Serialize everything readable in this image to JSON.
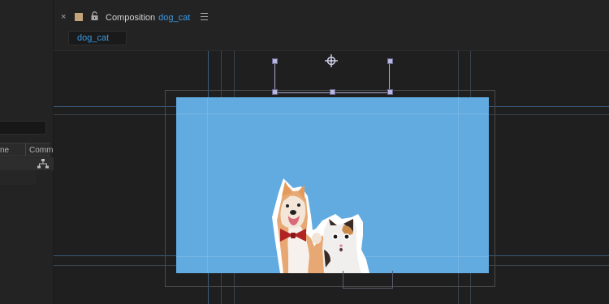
{
  "comp_panel": {
    "close_label": "×",
    "title_prefix": "Composition",
    "comp_name": "dog_cat",
    "tab_label": "dog_cat",
    "menu_icon": "hamburger-menu-icon",
    "lock_icon": "lock-icon",
    "label_color": "#c4a57a"
  },
  "project_panel": {
    "col_name_label": "ne",
    "col_comment_label": "Comm",
    "flowchart_icon": "flowchart-icon"
  },
  "viewer": {
    "comp_background": "#62abe0",
    "guide_color": "#508cc8",
    "anchor_icon": "anchor-point-icon",
    "layer_image": "dog-and-cat-image"
  }
}
